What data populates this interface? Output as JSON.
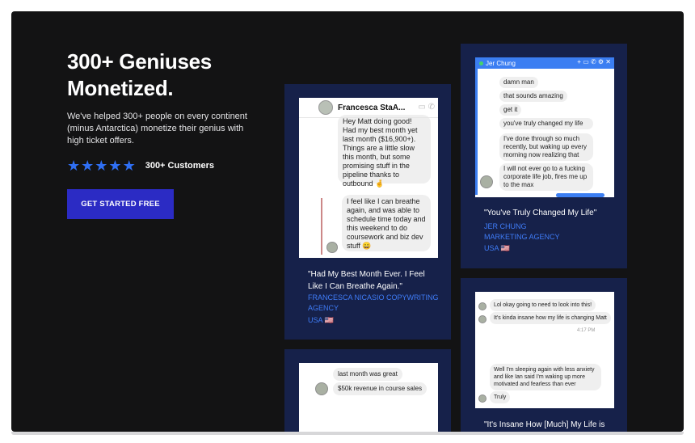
{
  "hero": {
    "title": "300+ Geniuses Monetized.",
    "description": "We've helped 300+ people on every continent (minus Antarctica) monetize their genius with high ticket offers.",
    "rating_label": "300+ Customers",
    "star_count": 5,
    "cta_label": "GET STARTED FREE"
  },
  "colors": {
    "background": "#131314",
    "card": "#16214a",
    "accent_blue": "#3f7cf7",
    "cta": "#2b2bc4",
    "star": "#2f6ff4"
  },
  "testimonials": [
    {
      "quote": "\"Had My Best Month Ever. I Feel Like I Can Breathe Again.\"",
      "author_line1": "FRANCESCA NICASIO COPYWRITING",
      "author_line2": "AGENCY",
      "location": "USA 🇺🇸",
      "chat": {
        "contact": "Francesca StaA...",
        "msg1": "Hey Matt doing good! Had my best month yet last month ($16,900+). Things are a little slow this month, but some promising stuff in the pipeline thanks to outbound 🤞",
        "msg2": "I feel like I can breathe again, and was able to schedule time today and this weekend to do coursework and biz dev stuff 😀"
      }
    },
    {
      "quote": "\"You've Truly Changed My Life\"",
      "author_line1": "JER CHUNG",
      "author_line2": "MARKETING AGENCY",
      "location": "USA 🇺🇸",
      "chat": {
        "contact": "Jer Chung",
        "messages": [
          "damn man",
          "that sounds amazing",
          "get it",
          "you've truly changed my life",
          "I've done through so much recently, but waking up every morning now realizing that",
          "I will not ever go to a fucking corporate life job, fires me up to the max"
        ]
      }
    },
    {
      "quote": "\"It's Insane How [Much] My Life is",
      "chat": {
        "messages": [
          "Lol okay going to need to look into this!",
          "It's kinda insane how my life is changing Matt",
          "Well I'm sleeping again with less anxiety and like Ian said I'm waking up more motivated and fearless than ever",
          "Truly"
        ],
        "time": "4:17 PM"
      }
    },
    {
      "chat": {
        "messages": [
          "last month was great",
          "$50k revenue in course sales"
        ]
      }
    }
  ]
}
